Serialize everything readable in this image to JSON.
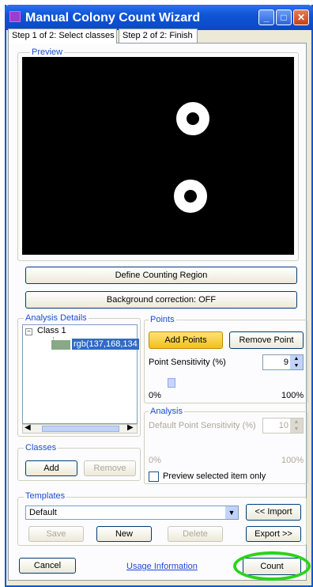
{
  "window": {
    "title": "Manual Colony Count Wizard"
  },
  "tabs": [
    {
      "label": "Step 1 of 2: Select classes"
    },
    {
      "label": "Step 2 of 2: Finish"
    }
  ],
  "preview": {
    "label": "Preview"
  },
  "buttons": {
    "define_region": "Define Counting Region",
    "background_correction": "Background correction: OFF"
  },
  "analysis_details": {
    "label": "Analysis Details",
    "class_label": "Class 1",
    "class_swatch_color": "#89a886",
    "rgb_text": "rgb(137,168,134"
  },
  "points": {
    "label": "Points",
    "add": "Add Points",
    "remove": "Remove Point",
    "sensitivity_label": "Point Sensitivity (%)",
    "sensitivity_value": "9",
    "slider_level_percent": 9,
    "min": "0%",
    "max": "100%"
  },
  "analysis": {
    "label": "Analysis",
    "default_sensitivity_label": "Default Point Sensitivity (%)",
    "default_value": "10",
    "min": "0%",
    "max": "100%",
    "preview_check": "Preview selected item only"
  },
  "classes": {
    "label": "Classes",
    "add": "Add",
    "remove": "Remove"
  },
  "templates": {
    "label": "Templates",
    "selected": "Default",
    "import": "<< Import",
    "save": "Save",
    "new": "New",
    "delete": "Delete",
    "export": "Export >>"
  },
  "footer": {
    "cancel": "Cancel",
    "usage": "Usage Information",
    "count": "Count"
  }
}
